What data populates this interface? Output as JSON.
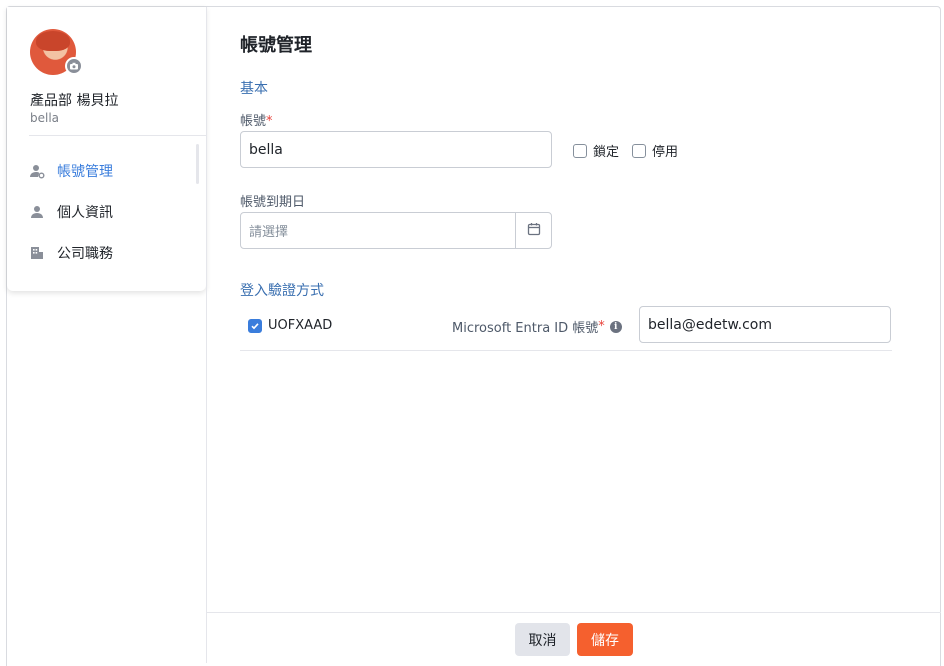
{
  "colors": {
    "accent": "#3a7ddc",
    "primary_button": "#f5602e",
    "required": "#e8423b",
    "section_title": "#3a6fb0"
  },
  "sidebar": {
    "user_name": "產品部 楊貝拉",
    "user_id": "bella",
    "items": [
      {
        "label": "帳號管理",
        "icon": "user-gear-icon",
        "active": true
      },
      {
        "label": "個人資訊",
        "icon": "user-icon",
        "active": false
      },
      {
        "label": "公司職務",
        "icon": "building-icon",
        "active": false
      }
    ]
  },
  "main": {
    "title": "帳號管理",
    "basic": {
      "section_title": "基本",
      "account_label": "帳號",
      "required_mark": "*",
      "account_value": "bella",
      "lock_label": "鎖定",
      "disable_label": "停用",
      "lock_checked": false,
      "disable_checked": false,
      "expiry_label": "帳號到期日",
      "expiry_placeholder": "請選擇"
    },
    "auth": {
      "section_title": "登入驗證方式",
      "method_label": "UOFXAAD",
      "method_checked": true,
      "ms_label": "Microsoft Entra ID 帳號",
      "required_mark": "*",
      "info_glyph": "i",
      "ms_value": "bella@edetw.com"
    }
  },
  "footer": {
    "cancel_label": "取消",
    "save_label": "儲存"
  }
}
